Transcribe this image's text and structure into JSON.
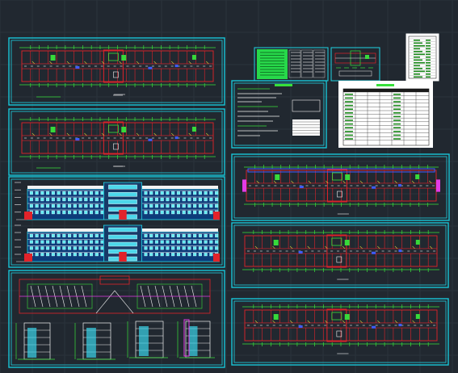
{
  "viewport": {
    "background_color": "#212830",
    "accent_colors": {
      "frame": "#17c6d8",
      "wall": "#e2232a",
      "dimension": "#38e03a",
      "text": "#f2f2f2",
      "highlight": "#3e5cff",
      "annotation": "#e33be6"
    }
  },
  "sheets": [
    {
      "id": "plan-1",
      "kind": "floor-plan"
    },
    {
      "id": "plan-2",
      "kind": "floor-plan"
    },
    {
      "id": "elevation-pair",
      "kind": "elevation"
    },
    {
      "id": "roof-and-sections",
      "kind": "roof-plan-and-sections"
    },
    {
      "id": "notes-sheet",
      "kind": "design-notes"
    },
    {
      "id": "schedule-sheet",
      "kind": "door-window-schedule"
    },
    {
      "id": "index-green",
      "kind": "drawing-index"
    },
    {
      "id": "keyplan",
      "kind": "key-plan"
    },
    {
      "id": "title-list",
      "kind": "drawing-list"
    },
    {
      "id": "plan-3",
      "kind": "floor-plan"
    },
    {
      "id": "plan-4",
      "kind": "floor-plan"
    },
    {
      "id": "plan-5",
      "kind": "floor-plan"
    }
  ]
}
